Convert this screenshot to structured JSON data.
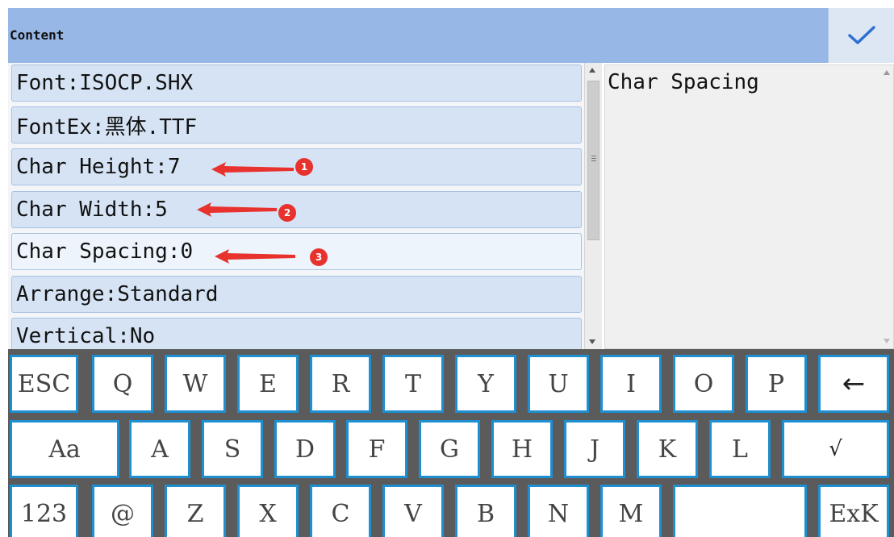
{
  "header": {
    "title": "Content",
    "confirm_icon": "checkmark-icon"
  },
  "properties": [
    {
      "label": "Font:ISOCP.SHX"
    },
    {
      "label": "FontEx:黑体.TTF"
    },
    {
      "label": "Char Height:7"
    },
    {
      "label": "Char Width:5"
    },
    {
      "label": "Char Spacing:0",
      "selected": true
    },
    {
      "label": "Arrange:Standard"
    },
    {
      "label": "Vertical:No"
    }
  ],
  "description": {
    "text": "Char Spacing"
  },
  "annotations": [
    "1",
    "2",
    "3"
  ],
  "keyboard": {
    "row1": [
      "ESC",
      "Q",
      "W",
      "E",
      "R",
      "T",
      "Y",
      "U",
      "I",
      "O",
      "P",
      "←"
    ],
    "row2": [
      "Aa",
      "A",
      "S",
      "D",
      "F",
      "G",
      "H",
      "J",
      "K",
      "L",
      "√"
    ],
    "row3": [
      "123",
      "@",
      "Z",
      "X",
      "C",
      "V",
      "B",
      "N",
      "M",
      "",
      "ExK"
    ]
  },
  "colors": {
    "header_bg": "#97b7e6",
    "row_bg": "#d5e3f4",
    "key_border": "#1e8fd0",
    "keyboard_bg": "#5b5b5b",
    "annotation": "#e8322d"
  }
}
